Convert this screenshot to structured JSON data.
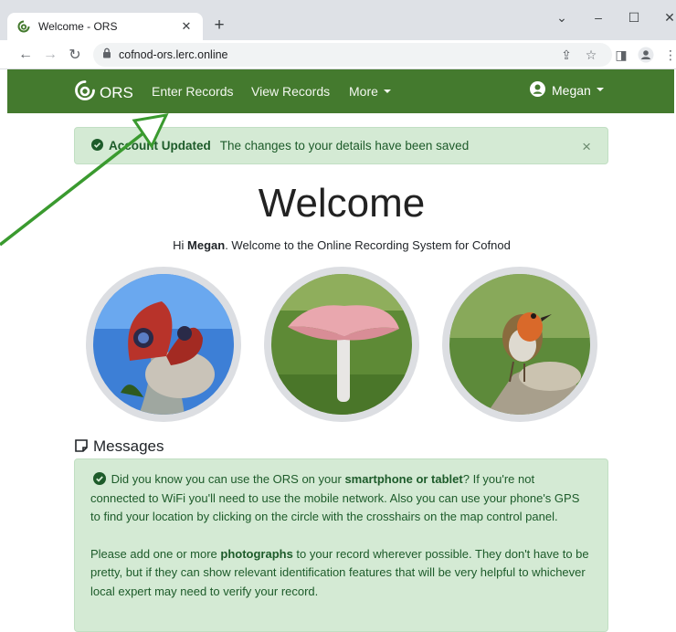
{
  "browser": {
    "tab_title": "Welcome - ORS",
    "url": "cofnod-ors.lerc.online"
  },
  "navbar": {
    "brand": "ORS",
    "links": [
      "Enter Records",
      "View Records",
      "More"
    ],
    "user": "Megan"
  },
  "alert": {
    "title": "Account Updated",
    "message": "The changes to your details have been saved",
    "close": "×"
  },
  "welcome": {
    "title": "Welcome",
    "greeting_prefix": "Hi ",
    "user": "Megan",
    "greeting_suffix": ". Welcome to the Online Recording System for Cofnod"
  },
  "messages": {
    "heading": "Messages",
    "p1_a": " Did you know you can use the ORS on your ",
    "p1_b": "smartphone or tablet",
    "p1_c": "? If you're not connected to WiFi you'll need to use the mobile network. Also you can use your phone's GPS to find your location by clicking on the circle with the crosshairs on the map control panel.",
    "p2_a": "Please add one or more ",
    "p2_b": "photographs",
    "p2_c": " to your record wherever possible. They don't have to be pretty, but if they can show relevant identification features that will be very helpful to whichever local expert may need to verify your record."
  },
  "images": [
    "butterfly-photo",
    "mushroom-photo",
    "robin-photo"
  ],
  "colors": {
    "navbar": "#447a2e",
    "alert_bg": "#d4ead4",
    "arrow": "#3a9a2f"
  }
}
